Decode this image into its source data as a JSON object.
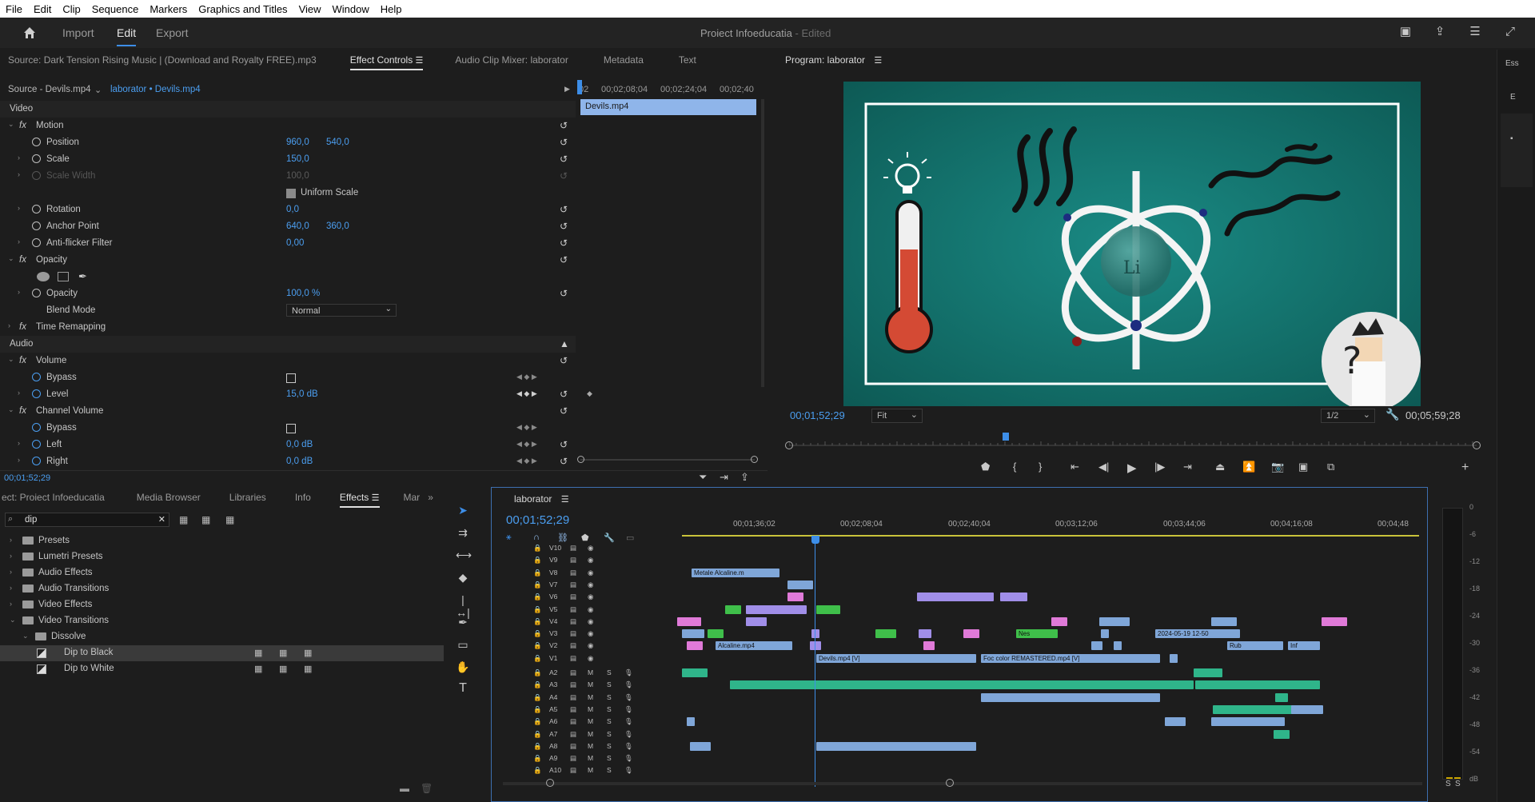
{
  "menu": [
    "File",
    "Edit",
    "Clip",
    "Sequence",
    "Markers",
    "Graphics and Titles",
    "View",
    "Window",
    "Help"
  ],
  "workspace": {
    "tabs": [
      "Import",
      "Edit",
      "Export"
    ],
    "active": "Edit",
    "project_title": "Proiect Infoeducatia",
    "edited_suffix": "- Edited"
  },
  "source_panel": {
    "tabs": [
      "Source: Dark Tension Rising Music  |  (Download and Royalty FREE).mp3",
      "Effect Controls",
      "Audio Clip Mixer: laborator",
      "Metadata",
      "Text"
    ],
    "active_tab": "Effect Controls",
    "clip_source": "Source - Devils.mp4",
    "clip_target": "laborator • Devils.mp4",
    "ruler": [
      "02",
      "00;02;08;04",
      "00;02;24;04",
      "00;02;40"
    ],
    "mini_clip": "Devils.mp4",
    "timecode": "00;01;52;29",
    "video_label": "Video",
    "audio_label": "Audio",
    "motion": {
      "name": "Motion",
      "position_label": "Position",
      "position_x": "960,0",
      "position_y": "540,0",
      "scale_label": "Scale",
      "scale": "150,0",
      "scale_width_label": "Scale Width",
      "scale_width": "100,0",
      "uniform_label": "Uniform Scale",
      "rotation_label": "Rotation",
      "rotation": "0,0",
      "anchor_label": "Anchor Point",
      "anchor_x": "640,0",
      "anchor_y": "360,0",
      "flicker_label": "Anti-flicker Filter",
      "flicker": "0,00"
    },
    "opacity": {
      "name": "Opacity",
      "opacity_label": "Opacity",
      "opacity": "100,0 %",
      "blend_label": "Blend Mode",
      "blend": "Normal"
    },
    "time_remap": "Time Remapping",
    "volume": {
      "name": "Volume",
      "bypass_label": "Bypass",
      "level_label": "Level",
      "level": "15,0 dB"
    },
    "channel_volume": {
      "name": "Channel Volume",
      "bypass_label": "Bypass",
      "left_label": "Left",
      "left": "0,0 dB",
      "right_label": "Right",
      "right": "0,0 dB"
    }
  },
  "program": {
    "title": "Program: laborator",
    "timecode": "00;01;52;29",
    "fit": "Fit",
    "resolution": "1/2",
    "duration": "00;05;59;28",
    "playhead_fraction": 0.311
  },
  "project_panel": {
    "tabs": [
      "ect: Proiect Infoeducatia",
      "Media Browser",
      "Libraries",
      "Info",
      "Effects",
      "Mar"
    ],
    "active_tab": "Effects",
    "search": "dip",
    "tree": [
      {
        "label": "Presets",
        "level": 0,
        "open": false
      },
      {
        "label": "Lumetri Presets",
        "level": 0,
        "open": false
      },
      {
        "label": "Audio Effects",
        "level": 0,
        "open": false
      },
      {
        "label": "Audio Transitions",
        "level": 0,
        "open": false
      },
      {
        "label": "Video Effects",
        "level": 0,
        "open": false
      },
      {
        "label": "Video Transitions",
        "level": 0,
        "open": true
      },
      {
        "label": "Dissolve",
        "level": 1,
        "open": true
      },
      {
        "label": "Dip to Black",
        "level": 2,
        "selected": true
      },
      {
        "label": "Dip to White",
        "level": 2,
        "selected": false
      }
    ]
  },
  "timeline": {
    "title": "laborator",
    "timecode": "00;01;52;29",
    "ruler": [
      "00;01;36;02",
      "00;02;08;04",
      "00;02;40;04",
      "00;03;12;06",
      "00;03;44;06",
      "00;04;16;08",
      "00;04;48"
    ],
    "video_tracks": [
      "V10",
      "V9",
      "V8",
      "V7",
      "V6",
      "V5",
      "V4",
      "V3",
      "V2",
      "V1"
    ],
    "audio_tracks": [
      "A2",
      "A3",
      "A4",
      "A5",
      "A6",
      "A7",
      "A8",
      "A9",
      "A10"
    ],
    "clip_labels": {
      "metale": "Metale Alcaline.m",
      "nes": "Nes",
      "date": "2024-05-19 12-50",
      "alcaline": "Alcaline.mp4",
      "rub": "Rub",
      "inf": "Inf",
      "devils": "Devils.mp4 [V]",
      "foc": "Foc color REMASTERED.mp4 [V]"
    }
  },
  "meter": {
    "labels": [
      "0",
      "-6",
      "-12",
      "-18",
      "-24",
      "-30",
      "-36",
      "-42",
      "-48",
      "-54",
      "dB"
    ],
    "solo": [
      "S",
      "S"
    ]
  },
  "colors": {
    "accent": "#3d8ee8",
    "clip_violet": "#a08ee8",
    "clip_pink": "#e07ad8",
    "clip_green": "#3fbf4a",
    "clip_blue": "#7fa6d8",
    "clip_audio": "#2fb58a"
  }
}
